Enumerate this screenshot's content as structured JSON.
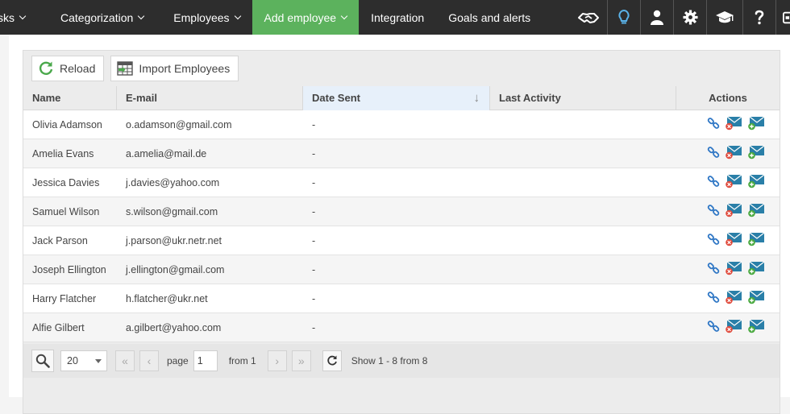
{
  "nav": {
    "items": [
      {
        "label": "sks"
      },
      {
        "label": "Categorization"
      },
      {
        "label": "Employees"
      },
      {
        "label": "Add employee"
      },
      {
        "label": "Integration"
      },
      {
        "label": "Goals and alerts"
      }
    ],
    "icons": [
      "handshake-icon",
      "lightbulb-icon",
      "user-icon",
      "gear-icon",
      "graduation-cap-icon",
      "help-icon",
      "logout-icon"
    ],
    "active_color": "#5cb25d"
  },
  "toolbar": {
    "reload_label": "Reload",
    "import_label": "Import Employees"
  },
  "table": {
    "columns": [
      "Name",
      "E-mail",
      "Date Sent",
      "Last Activity",
      "Actions"
    ],
    "sort_indicator": "↓",
    "rows": [
      {
        "name": "Olivia Adamson",
        "email": "o.adamson@gmail.com",
        "date_sent": "-",
        "last_activity": ""
      },
      {
        "name": "Amelia Evans",
        "email": "a.amelia@mail.de",
        "date_sent": "-",
        "last_activity": ""
      },
      {
        "name": "Jessica Davies",
        "email": "j.davies@yahoo.com",
        "date_sent": "-",
        "last_activity": ""
      },
      {
        "name": "Samuel Wilson",
        "email": "s.wilson@gmail.com",
        "date_sent": "-",
        "last_activity": ""
      },
      {
        "name": "Jack Parson",
        "email": "j.parson@ukr.netr.net",
        "date_sent": "-",
        "last_activity": ""
      },
      {
        "name": "Joseph Ellington",
        "email": "j.ellington@gmail.com",
        "date_sent": "-",
        "last_activity": ""
      },
      {
        "name": "Harry Flatcher",
        "email": "h.flatcher@ukr.net",
        "date_sent": "-",
        "last_activity": ""
      },
      {
        "name": "Alfie Gilbert",
        "email": "a.gilbert@yahoo.com",
        "date_sent": "-",
        "last_activity": ""
      }
    ]
  },
  "pager": {
    "page_size": "20",
    "page_label": "page",
    "page_value": "1",
    "from_label": "from 1",
    "show_text": "Show 1 - 8 from 8"
  }
}
